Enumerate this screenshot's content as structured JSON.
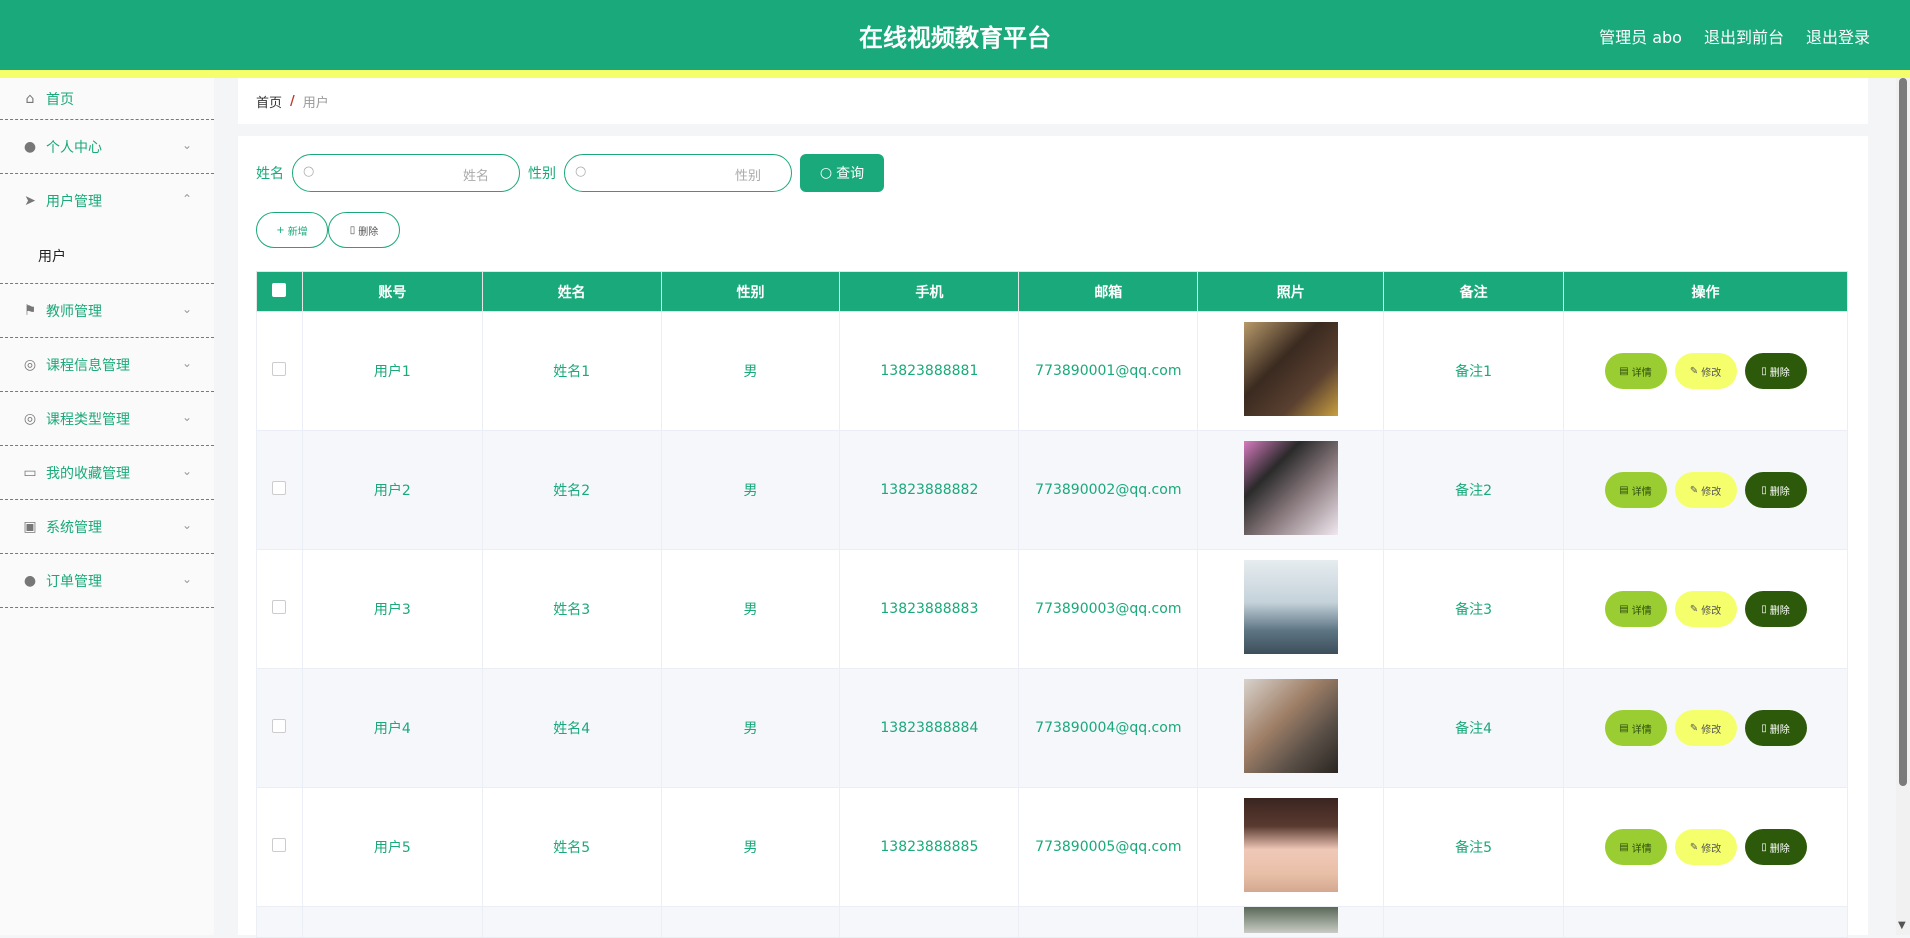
{
  "header": {
    "title": "在线视频教育平台",
    "admin": "管理员 abo",
    "back_front": "退出到前台",
    "logout": "退出登录"
  },
  "sidebar": {
    "items": [
      {
        "label": "首页",
        "icon": "home-icon"
      },
      {
        "label": "个人中心",
        "icon": "user-icon"
      },
      {
        "label": "用户管理",
        "icon": "send-icon",
        "expanded": true,
        "sub": [
          "用户"
        ]
      },
      {
        "label": "教师管理",
        "icon": "flag-icon"
      },
      {
        "label": "课程信息管理",
        "icon": "compass-icon"
      },
      {
        "label": "课程类型管理",
        "icon": "compass-icon"
      },
      {
        "label": "我的收藏管理",
        "icon": "card-icon"
      },
      {
        "label": "系统管理",
        "icon": "clipboard-icon"
      },
      {
        "label": "订单管理",
        "icon": "user-solid-icon"
      }
    ]
  },
  "breadcrumb": {
    "home": "首页",
    "sep": "/",
    "current": "用户"
  },
  "search": {
    "name_label": "姓名",
    "name_placeholder": "姓名",
    "gender_label": "性别",
    "gender_placeholder": "性别",
    "query_button": "查询"
  },
  "actions": {
    "add": "新增",
    "delete": "删除"
  },
  "table": {
    "headers": [
      "账号",
      "姓名",
      "性别",
      "手机",
      "邮箱",
      "照片",
      "备注",
      "操作"
    ],
    "rows": [
      {
        "account": "用户1",
        "name": "姓名1",
        "gender": "男",
        "phone": "13823888881",
        "email": "773890001@qq.com",
        "note": "备注1",
        "photo_color": "#3a2a20"
      },
      {
        "account": "用户2",
        "name": "姓名2",
        "gender": "男",
        "phone": "13823888882",
        "email": "773890002@qq.com",
        "note": "备注2",
        "photo_color": "#6a5a5e"
      },
      {
        "account": "用户3",
        "name": "姓名3",
        "gender": "男",
        "phone": "13823888883",
        "email": "773890003@qq.com",
        "note": "备注3",
        "photo_color": "#9fb6c8"
      },
      {
        "account": "用户4",
        "name": "姓名4",
        "gender": "男",
        "phone": "13823888884",
        "email": "773890004@qq.com",
        "note": "备注4",
        "photo_color": "#7c6a5c"
      },
      {
        "account": "用户5",
        "name": "姓名5",
        "gender": "男",
        "phone": "13823888885",
        "email": "773890005@qq.com",
        "note": "备注5",
        "photo_color": "#c8a08a"
      }
    ],
    "row_actions": {
      "detail": "详情",
      "edit": "修改",
      "delete": "删除"
    }
  },
  "colors": {
    "primary": "#1aa97a",
    "accent_yellow": "#f5ff6b",
    "detail_green": "#9acd32",
    "delete_dark": "#2d5a0a"
  }
}
